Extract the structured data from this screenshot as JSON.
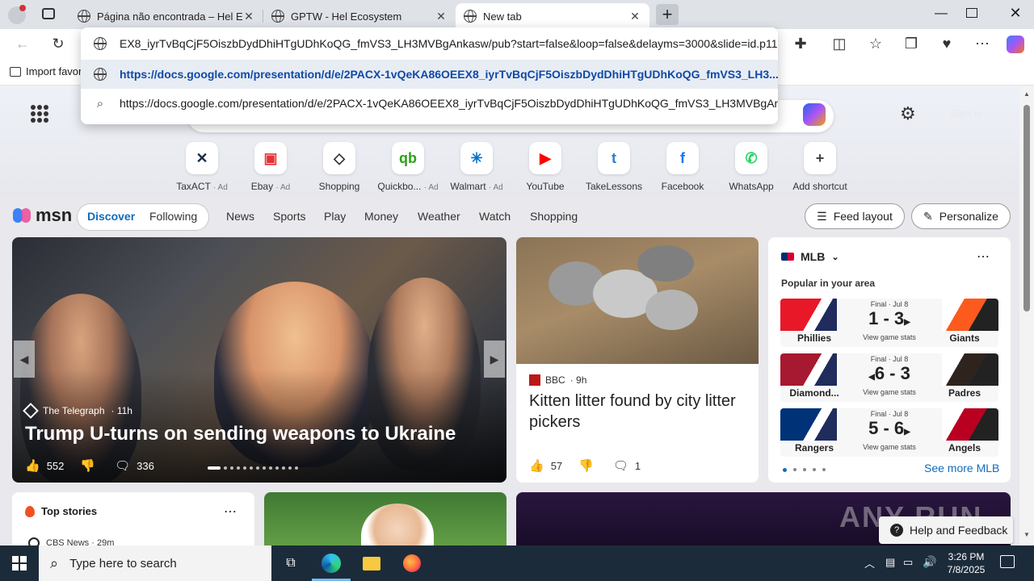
{
  "tabs": [
    {
      "title": "Página não encontrada – Hel Eco:",
      "active": false
    },
    {
      "title": "GPTW - Hel Ecosystem",
      "active": false
    },
    {
      "title": "New tab",
      "active": true
    }
  ],
  "omnibox": {
    "current_text": "EX8_iyrTvBqCjF5OiszbDydDhiHTgUDhKoQG_fmVS3_LH3MVBgAnkasw/pub?start=false&loop=false&delayms=3000&slide=id.p11",
    "suggestion_url": "https://docs.google.com/presentation/d/e/2PACX-1vQeKA86OEEX8_iyrTvBqCjF5OiszbDydDhiHTgUDhKoQG_fmVS3_LH3...",
    "search_text": "https://docs.google.com/presentation/d/e/2PACX-1vQeKA86OEEX8_iyrTvBqCjF5OiszbDydDhiHTgUDhKoQG_fmVS3_LH3MVBgAn..."
  },
  "favorites": {
    "import_label": "Import favor"
  },
  "header": {
    "signin_label": "Sign in"
  },
  "shortcuts": [
    {
      "label": "TaxACT",
      "ad": "· Ad",
      "icon": "taxact-icon",
      "color": "#1a2b4a",
      "glyph": "✕"
    },
    {
      "label": "Ebay",
      "ad": "· Ad",
      "icon": "ebay-icon",
      "color": "#e53238",
      "glyph": "▣"
    },
    {
      "label": "Shopping",
      "ad": "",
      "icon": "tag-icon",
      "color": "#333333",
      "glyph": "◇"
    },
    {
      "label": "Quickbo...",
      "ad": "· Ad",
      "icon": "quickbooks-icon",
      "color": "#2ca01c",
      "glyph": "qb"
    },
    {
      "label": "Walmart",
      "ad": "· Ad",
      "icon": "walmart-icon",
      "color": "#0071ce",
      "glyph": "✳"
    },
    {
      "label": "YouTube",
      "ad": "",
      "icon": "youtube-icon",
      "color": "#ff0000",
      "glyph": "▶"
    },
    {
      "label": "TakeLessons",
      "ad": "",
      "icon": "takelessons-icon",
      "color": "#2a7fd4",
      "glyph": "t"
    },
    {
      "label": "Facebook",
      "ad": "",
      "icon": "facebook-icon",
      "color": "#1877f2",
      "glyph": "f"
    },
    {
      "label": "WhatsApp",
      "ad": "",
      "icon": "whatsapp-icon",
      "color": "#25d366",
      "glyph": "✆"
    },
    {
      "label": "Add shortcut",
      "ad": "",
      "icon": "plus-icon",
      "color": "#444444",
      "glyph": "+"
    }
  ],
  "nav": {
    "logo": "msn",
    "discover": "Discover",
    "following": "Following",
    "items": [
      "News",
      "Sports",
      "Play",
      "Money",
      "Weather",
      "Watch",
      "Shopping"
    ],
    "feed_layout": "Feed layout",
    "personalize": "Personalize"
  },
  "hero_story": {
    "source": "The Telegraph",
    "age": "· 11h",
    "headline": "Trump U-turns on sending weapons to Ukraine",
    "likes": "552",
    "comments": "336"
  },
  "kitten_story": {
    "source": "BBC",
    "age": "· 9h",
    "headline": "Kitten litter found by city litter pickers",
    "likes": "57",
    "comments": "1"
  },
  "mlb": {
    "title": "MLB",
    "subtitle": "Popular in your area",
    "see_more": "See more MLB",
    "games": [
      {
        "status": "Final · Jul 8",
        "score": "1 - 3",
        "arrow": "right",
        "home": "Phillies",
        "away": "Giants",
        "link": "View game stats",
        "home_color": "#e81828",
        "away_color": "#fd5a1e"
      },
      {
        "status": "Final · Jul 8",
        "score": "6 - 3",
        "arrow": "left",
        "home": "Diamond...",
        "away": "Padres",
        "link": "View game stats",
        "home_color": "#a71930",
        "away_color": "#2f241d"
      },
      {
        "status": "Final · Jul 8",
        "score": "5 - 6",
        "arrow": "right",
        "home": "Rangers",
        "away": "Angels",
        "link": "View game stats",
        "home_color": "#003278",
        "away_color": "#ba0021"
      }
    ]
  },
  "top_stories": {
    "title": "Top stories",
    "source": "CBS News · 29m"
  },
  "help": {
    "label": "Help and Feedback"
  },
  "watermark": "ANY RUN",
  "taskbar": {
    "search_placeholder": "Type here to search",
    "time": "3:26 PM",
    "date": "7/8/2025"
  }
}
